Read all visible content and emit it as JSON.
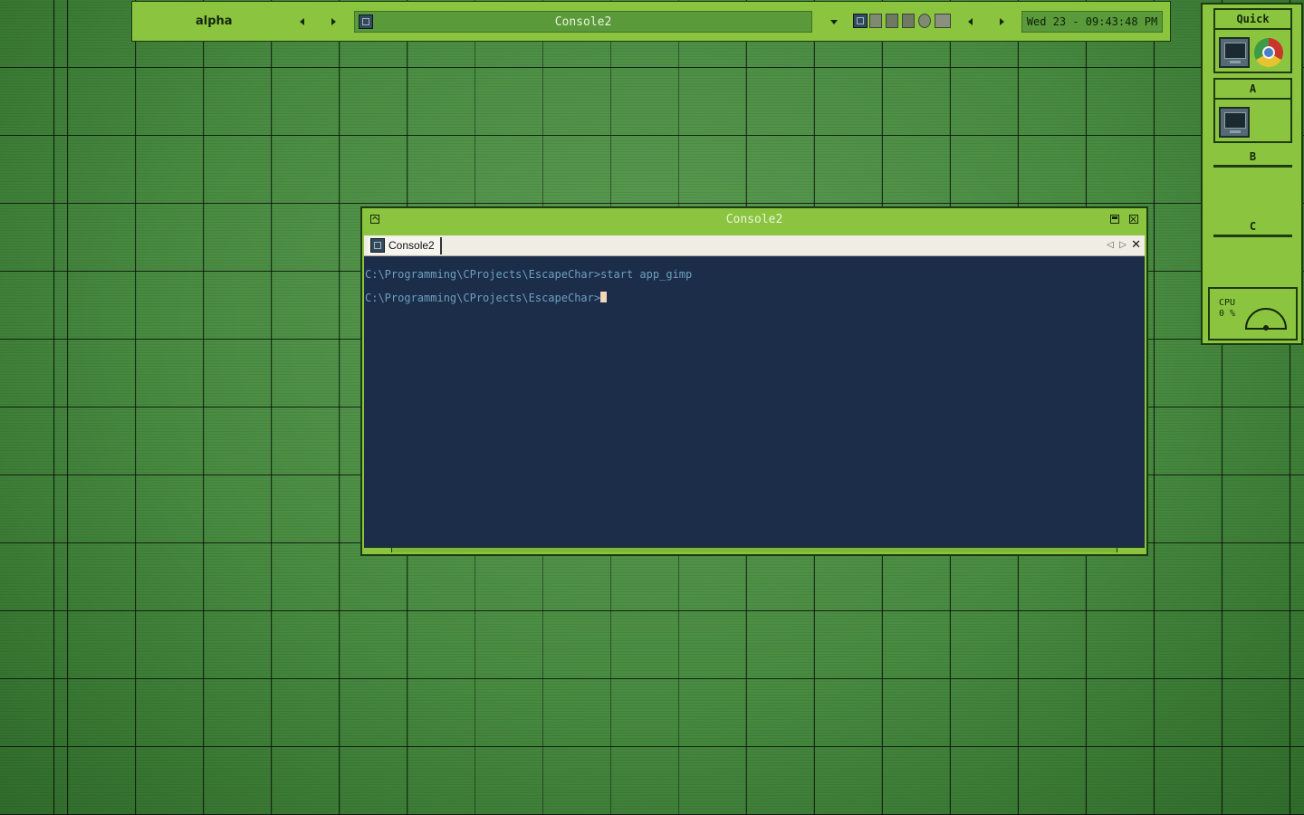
{
  "top_bar": {
    "workspace_label": "alpha",
    "task_title": "Console2",
    "clock": "Wed 23 - 09:43:48 PM"
  },
  "dock": {
    "groups": [
      {
        "title": "Quick",
        "icons": [
          "console-icon",
          "chrome-icon"
        ]
      },
      {
        "title": "A",
        "icons": [
          "console-icon"
        ]
      },
      {
        "title": "B",
        "icons": []
      },
      {
        "title": "C",
        "icons": []
      }
    ],
    "cpu": {
      "label": "CPU",
      "value": "0 %"
    }
  },
  "window": {
    "title": "Console2",
    "tab_label": "Console2",
    "console_lines": [
      "C:\\Programming\\CProjects\\EscapeChar>start app_gimp",
      "C:\\Programming\\CProjects\\EscapeChar>"
    ]
  },
  "colors": {
    "accent_green": "#8bc53f",
    "dark_outline": "#1d3a10",
    "console_bg": "#1b2d48",
    "console_text": "#6e9fbf"
  }
}
